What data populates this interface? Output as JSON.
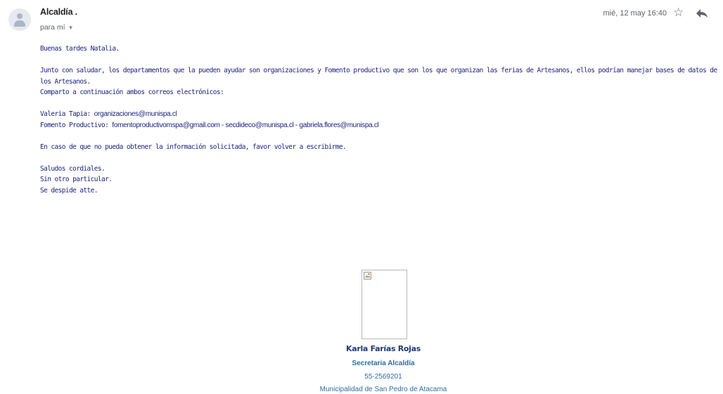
{
  "email": {
    "sender": "Alcaldía .",
    "to": "para mí",
    "date": "mié, 12 may 16:40",
    "icons": {
      "avatar": "person-icon",
      "star": "star-icon",
      "reply": "reply-icon",
      "more": "more-vert-icon"
    }
  },
  "body": {
    "greeting": "Buenas tardes Natalia.",
    "para1_line1": "Junto con saludar, los departamentos que la pueden ayudar son organizaciones y Fomento productivo que son los que organizan las ferias de Artesanos, ellos podrían manejar bases de datos de",
    "para1_line2": "los Artesanos.",
    "para1_line3": "Comparto a continuación ambos correos electrónicos:",
    "contact1_label": "Valeria Tapia: ",
    "contact1_email": "organizaciones@munispa.cl",
    "contact2_label": "Fomento Productivo: ",
    "contact2_emails": "fomentoproductivomspa@gmail.com - secdideco@munispa.cl - gabriela.flores@munispa.cl",
    "para3": "En caso de que no pueda obtener la información solicitada, favor volver a escribirme.",
    "closing1": "Saludos cordiales.",
    "closing2": "Sin otro particular.",
    "closing3": "Se despide atte."
  },
  "signature": {
    "name": "Karla Farías Rojas",
    "role": "Secretaria Alcaldía",
    "phone": "55-2569201",
    "org": "Municipalidad de San Pedro de Atacama"
  }
}
